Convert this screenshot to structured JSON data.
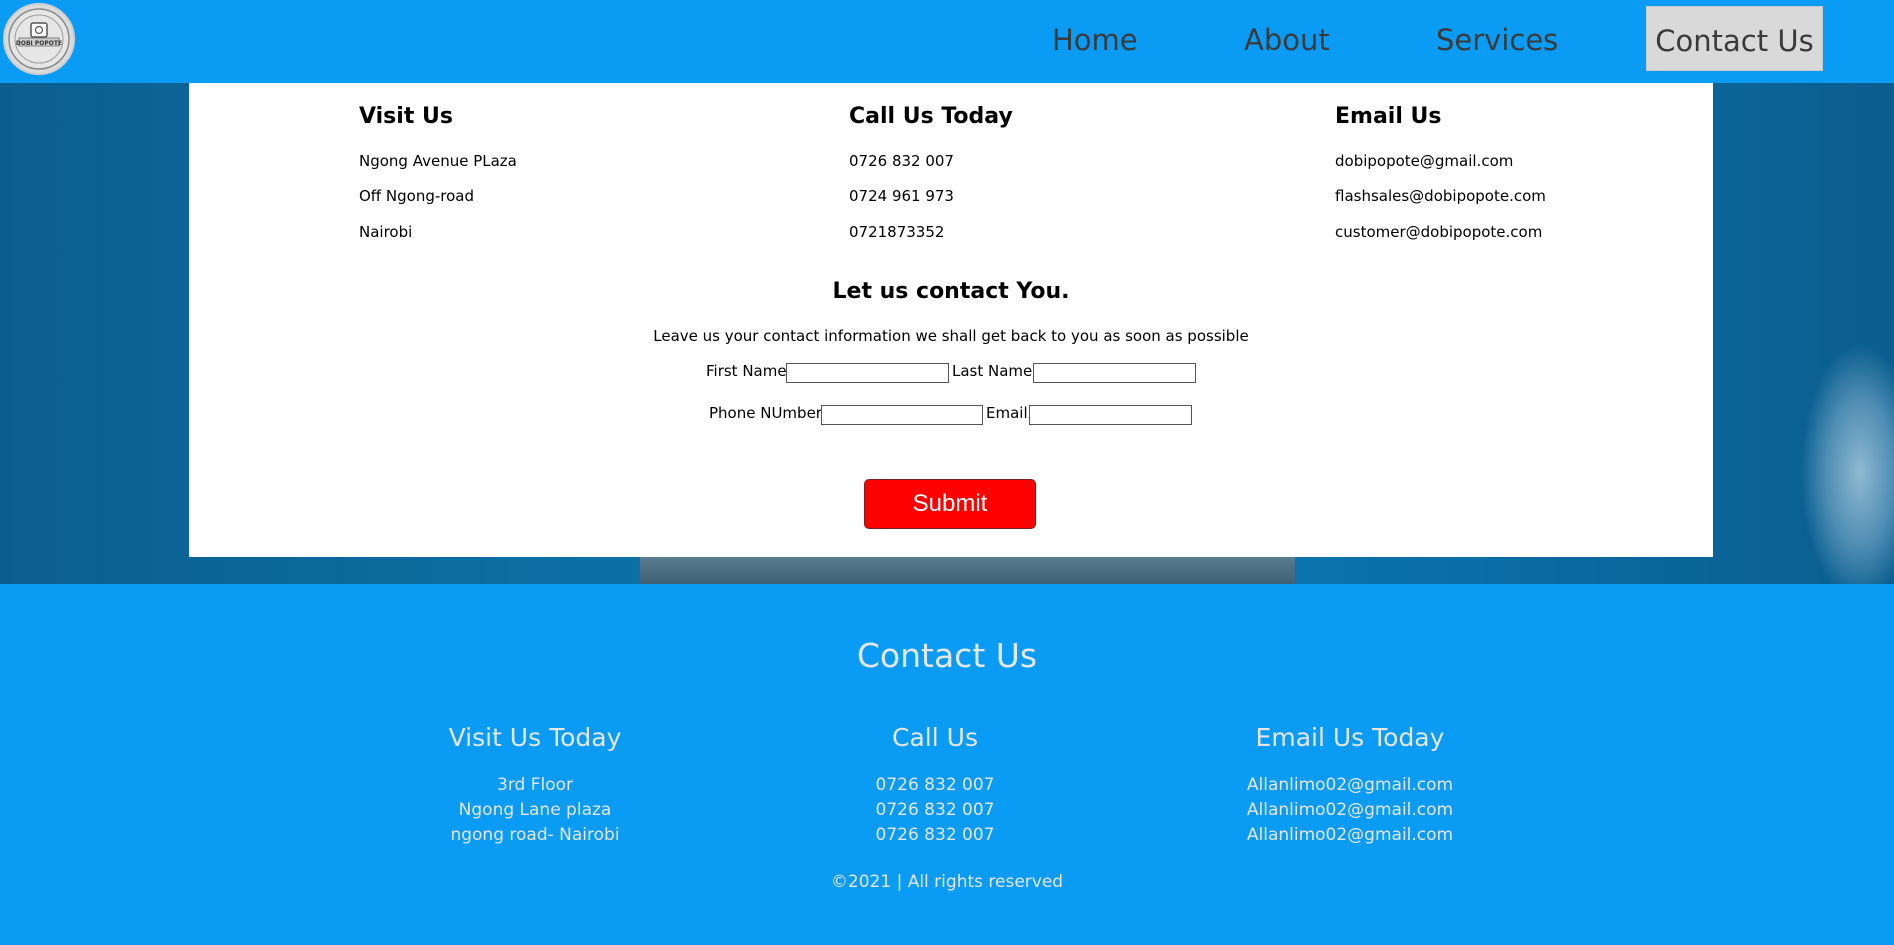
{
  "nav": {
    "logo_text": "DOBI POPOTE",
    "links": [
      "Home",
      "About",
      "Services"
    ],
    "active": "Contact Us"
  },
  "visit": {
    "title": "Visit Us",
    "lines": [
      "Ngong Avenue PLaza",
      "Off Ngong-road",
      "Nairobi"
    ]
  },
  "call": {
    "title": "Call Us Today",
    "lines": [
      "0726 832 007",
      "0724 961 973",
      "0721873352"
    ]
  },
  "email": {
    "title": "Email Us",
    "lines": [
      "dobipopote@gmail.com",
      "flashsales@dobipopote.com",
      "customer@dobipopote.com"
    ]
  },
  "form": {
    "title": "Let us contact You.",
    "subtitle": "Leave us your contact information we shall get back to you as soon as possible",
    "first_name_label": "First Name",
    "last_name_label": "Last Name",
    "phone_label": "Phone NUmber",
    "email_label": "Email",
    "submit_label": "Submit"
  },
  "footer": {
    "title": "Contact Us",
    "visit": {
      "title": "Visit Us Today",
      "lines": [
        "3rd Floor",
        "Ngong Lane plaza",
        "ngong road- Nairobi"
      ]
    },
    "call": {
      "title": "Call Us",
      "lines": [
        "0726 832 007",
        "0726 832 007",
        "0726 832 007"
      ]
    },
    "email": {
      "title": "Email Us Today",
      "lines": [
        "Allanlimo02@gmail.com",
        "Allanlimo02@gmail.com",
        "Allanlimo02@gmail.com"
      ]
    },
    "copyright": "©2021 | All rights reserved"
  },
  "colors": {
    "brand_blue": "#0a9cf5",
    "submit_red": "#ff0000",
    "active_tab": "#d9d9d9"
  }
}
